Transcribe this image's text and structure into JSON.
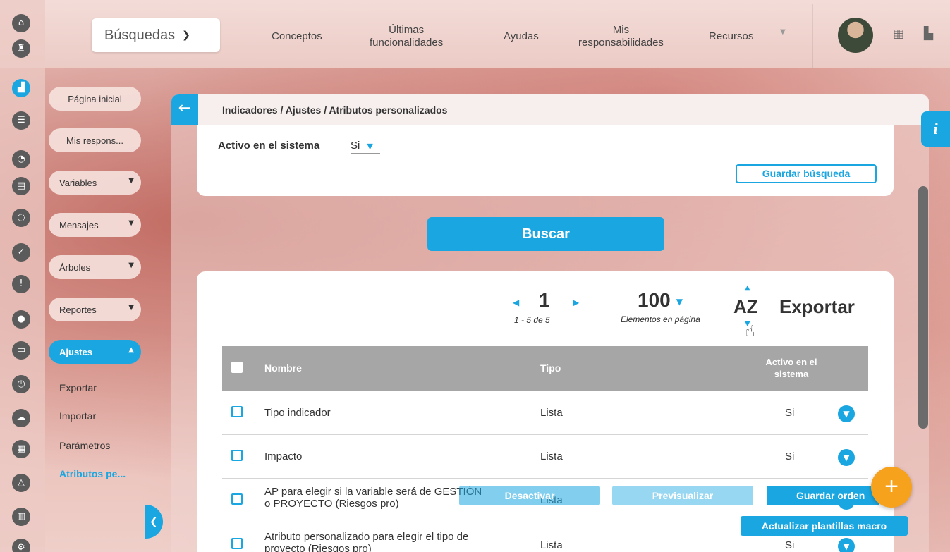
{
  "nav": {
    "search_label": "Búsquedas",
    "items": [
      {
        "line1": "Conceptos",
        "line2": ""
      },
      {
        "line1": "Últimas",
        "line2": "funcionalidades"
      },
      {
        "line1": "Ayudas",
        "line2": ""
      },
      {
        "line1": "Mis",
        "line2": "responsabilidades"
      },
      {
        "line1": "Recursos",
        "line2": ""
      }
    ]
  },
  "rail_icons": [
    "home-icon",
    "tower-icon",
    "indicators-icon",
    "process-icon",
    "pie-chart-icon",
    "document-icon",
    "cycle-icon",
    "check-icon",
    "warning-icon",
    "chat-icon",
    "presentation-icon",
    "clock-icon",
    "cloud-icon",
    "calendar-icon",
    "nodes-icon",
    "list-icon",
    "gear-icon"
  ],
  "subnav": {
    "home": "Página inicial",
    "mine": "Mis respons...",
    "variables": "Variables",
    "messages": "Mensajes",
    "trees": "Árboles",
    "reports": "Reportes",
    "settings": "Ajustes",
    "links": [
      "Exportar",
      "Importar",
      "Parámetros",
      "Atributos pe..."
    ]
  },
  "breadcrumb": "Indicadores / Ajustes / Atributos personalizados",
  "filter": {
    "label": "Activo en el sistema",
    "value": "Si",
    "save_search": "Guardar búsqueda"
  },
  "search_button": "Buscar",
  "pager": {
    "page": "1",
    "range": "1 - 5 de 5",
    "per_page": "100",
    "per_page_label": "Elementos en página",
    "sort": "AZ",
    "export": "Exportar"
  },
  "table": {
    "headers": {
      "name": "Nombre",
      "type": "Tipo",
      "active_1": "Activo en el",
      "active_2": "sistema"
    },
    "rows": [
      {
        "name_1": "Tipo indicador",
        "name_2": "",
        "type": "Lista",
        "active": "Si"
      },
      {
        "name_1": "Impacto",
        "name_2": "",
        "type": "Lista",
        "active": "Si"
      },
      {
        "name_1": "AP para elegir si la variable será de GESTIÓN",
        "name_2": "o PROYECTO (Riesgos pro)",
        "type": "Lista",
        "active": ""
      },
      {
        "name_1": "Atributo personalizado para elegir el tipo de",
        "name_2": "proyecto (Riesgos pro)",
        "type": "Lista",
        "active": "Si"
      }
    ]
  },
  "actions": {
    "deactivate": "Desactivar",
    "preview": "Previsualizar",
    "save_order": "Guardar orden",
    "update_templates": "Actualizar plantillas macro"
  },
  "colors": {
    "accent": "#1aa6e0",
    "fab": "#f7a21c",
    "header_gray": "#a6a6a6"
  }
}
